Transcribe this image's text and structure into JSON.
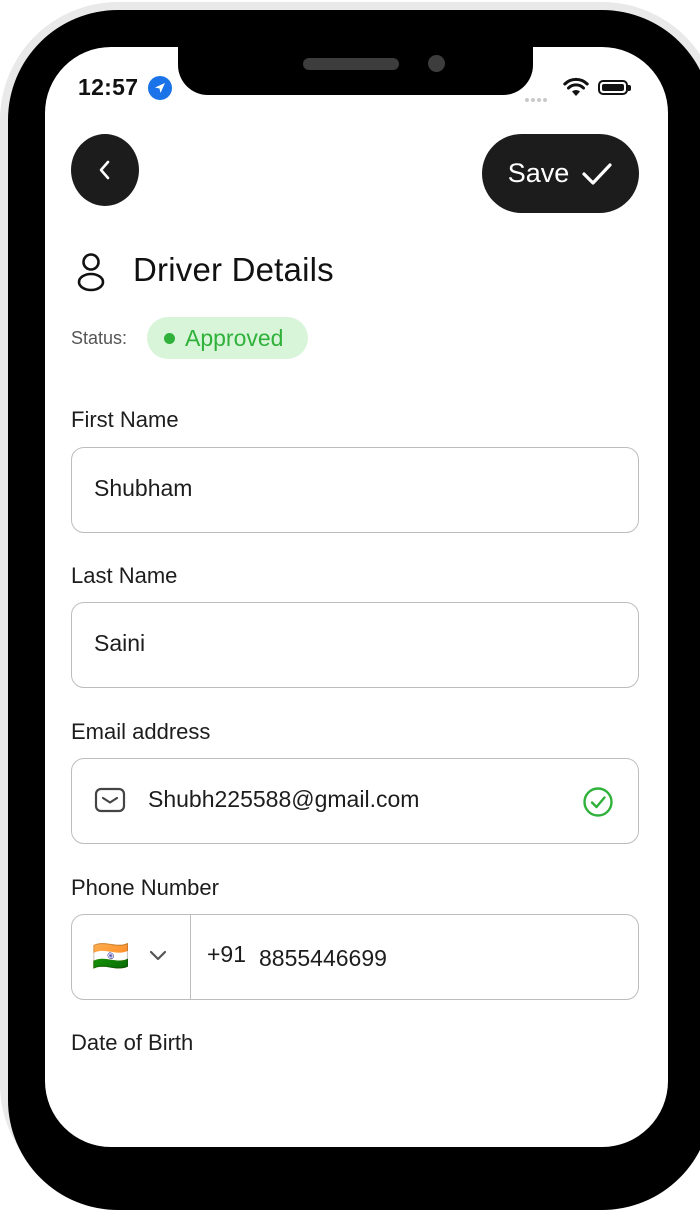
{
  "status_bar": {
    "time": "12:57"
  },
  "header": {
    "save_label": "Save",
    "title": "Driver Details"
  },
  "status": {
    "label": "Status:",
    "value": "Approved",
    "color": "#2fb13a"
  },
  "form": {
    "first_name": {
      "label": "First Name",
      "value": "Shubham"
    },
    "last_name": {
      "label": "Last Name",
      "value": "Saini"
    },
    "email": {
      "label": "Email address",
      "value": "Shubh225588@gmail.com"
    },
    "phone": {
      "label": "Phone Number",
      "flag": "🇮🇳",
      "code": "+91",
      "number": "8855446699"
    },
    "dob": {
      "label": "Date of Birth"
    }
  },
  "icons": [
    "location-arrow-icon",
    "wifi-icon",
    "battery-icon",
    "back-chevron-icon",
    "checkmark-icon",
    "person-icon",
    "mail-icon",
    "verified-check-icon",
    "chevron-down-icon"
  ]
}
